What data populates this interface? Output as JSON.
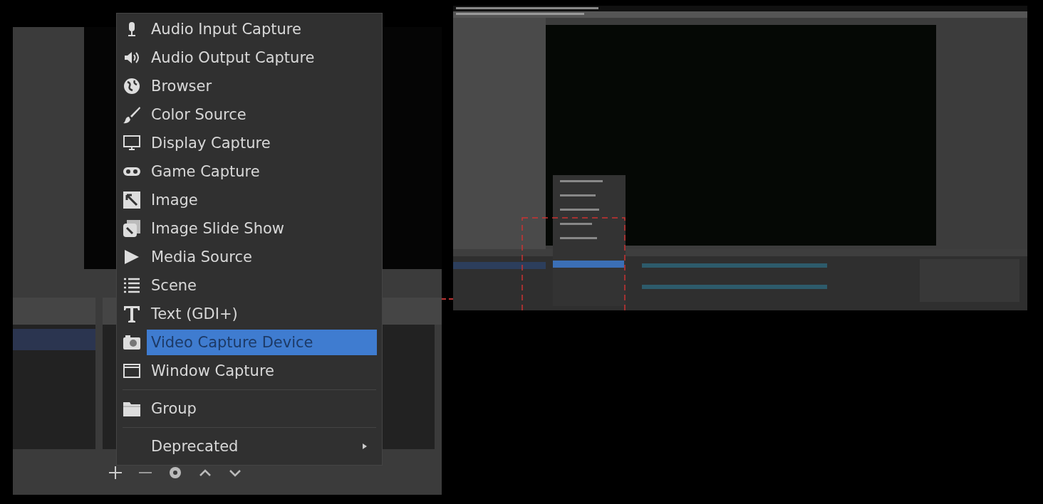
{
  "zoomed_menu": {
    "items": [
      {
        "kind": "item",
        "label": "Audio Input Capture",
        "selected": false
      },
      {
        "kind": "item",
        "label": "Audio Output Capture",
        "selected": false
      },
      {
        "kind": "item",
        "label": "Browser",
        "selected": false
      },
      {
        "kind": "item",
        "label": "Color Source",
        "selected": false
      },
      {
        "kind": "item",
        "label": "Display Capture",
        "selected": false
      },
      {
        "kind": "item",
        "label": "Game Capture",
        "selected": false
      },
      {
        "kind": "item",
        "label": "Image",
        "selected": false
      },
      {
        "kind": "item",
        "label": "Image Slide Show",
        "selected": false
      },
      {
        "kind": "item",
        "label": "Media Source",
        "selected": false
      },
      {
        "kind": "item",
        "label": "Scene",
        "selected": false
      },
      {
        "kind": "item",
        "label": "Text (GDI+)",
        "selected": false
      },
      {
        "kind": "item",
        "label": "Video Capture Device",
        "selected": true
      },
      {
        "kind": "item",
        "label": "Window Capture",
        "selected": false
      },
      {
        "kind": "separator"
      },
      {
        "kind": "item",
        "label": "Group",
        "selected": false
      },
      {
        "kind": "separator"
      },
      {
        "kind": "submenu",
        "label": "Deprecated",
        "selected": false
      }
    ]
  }
}
